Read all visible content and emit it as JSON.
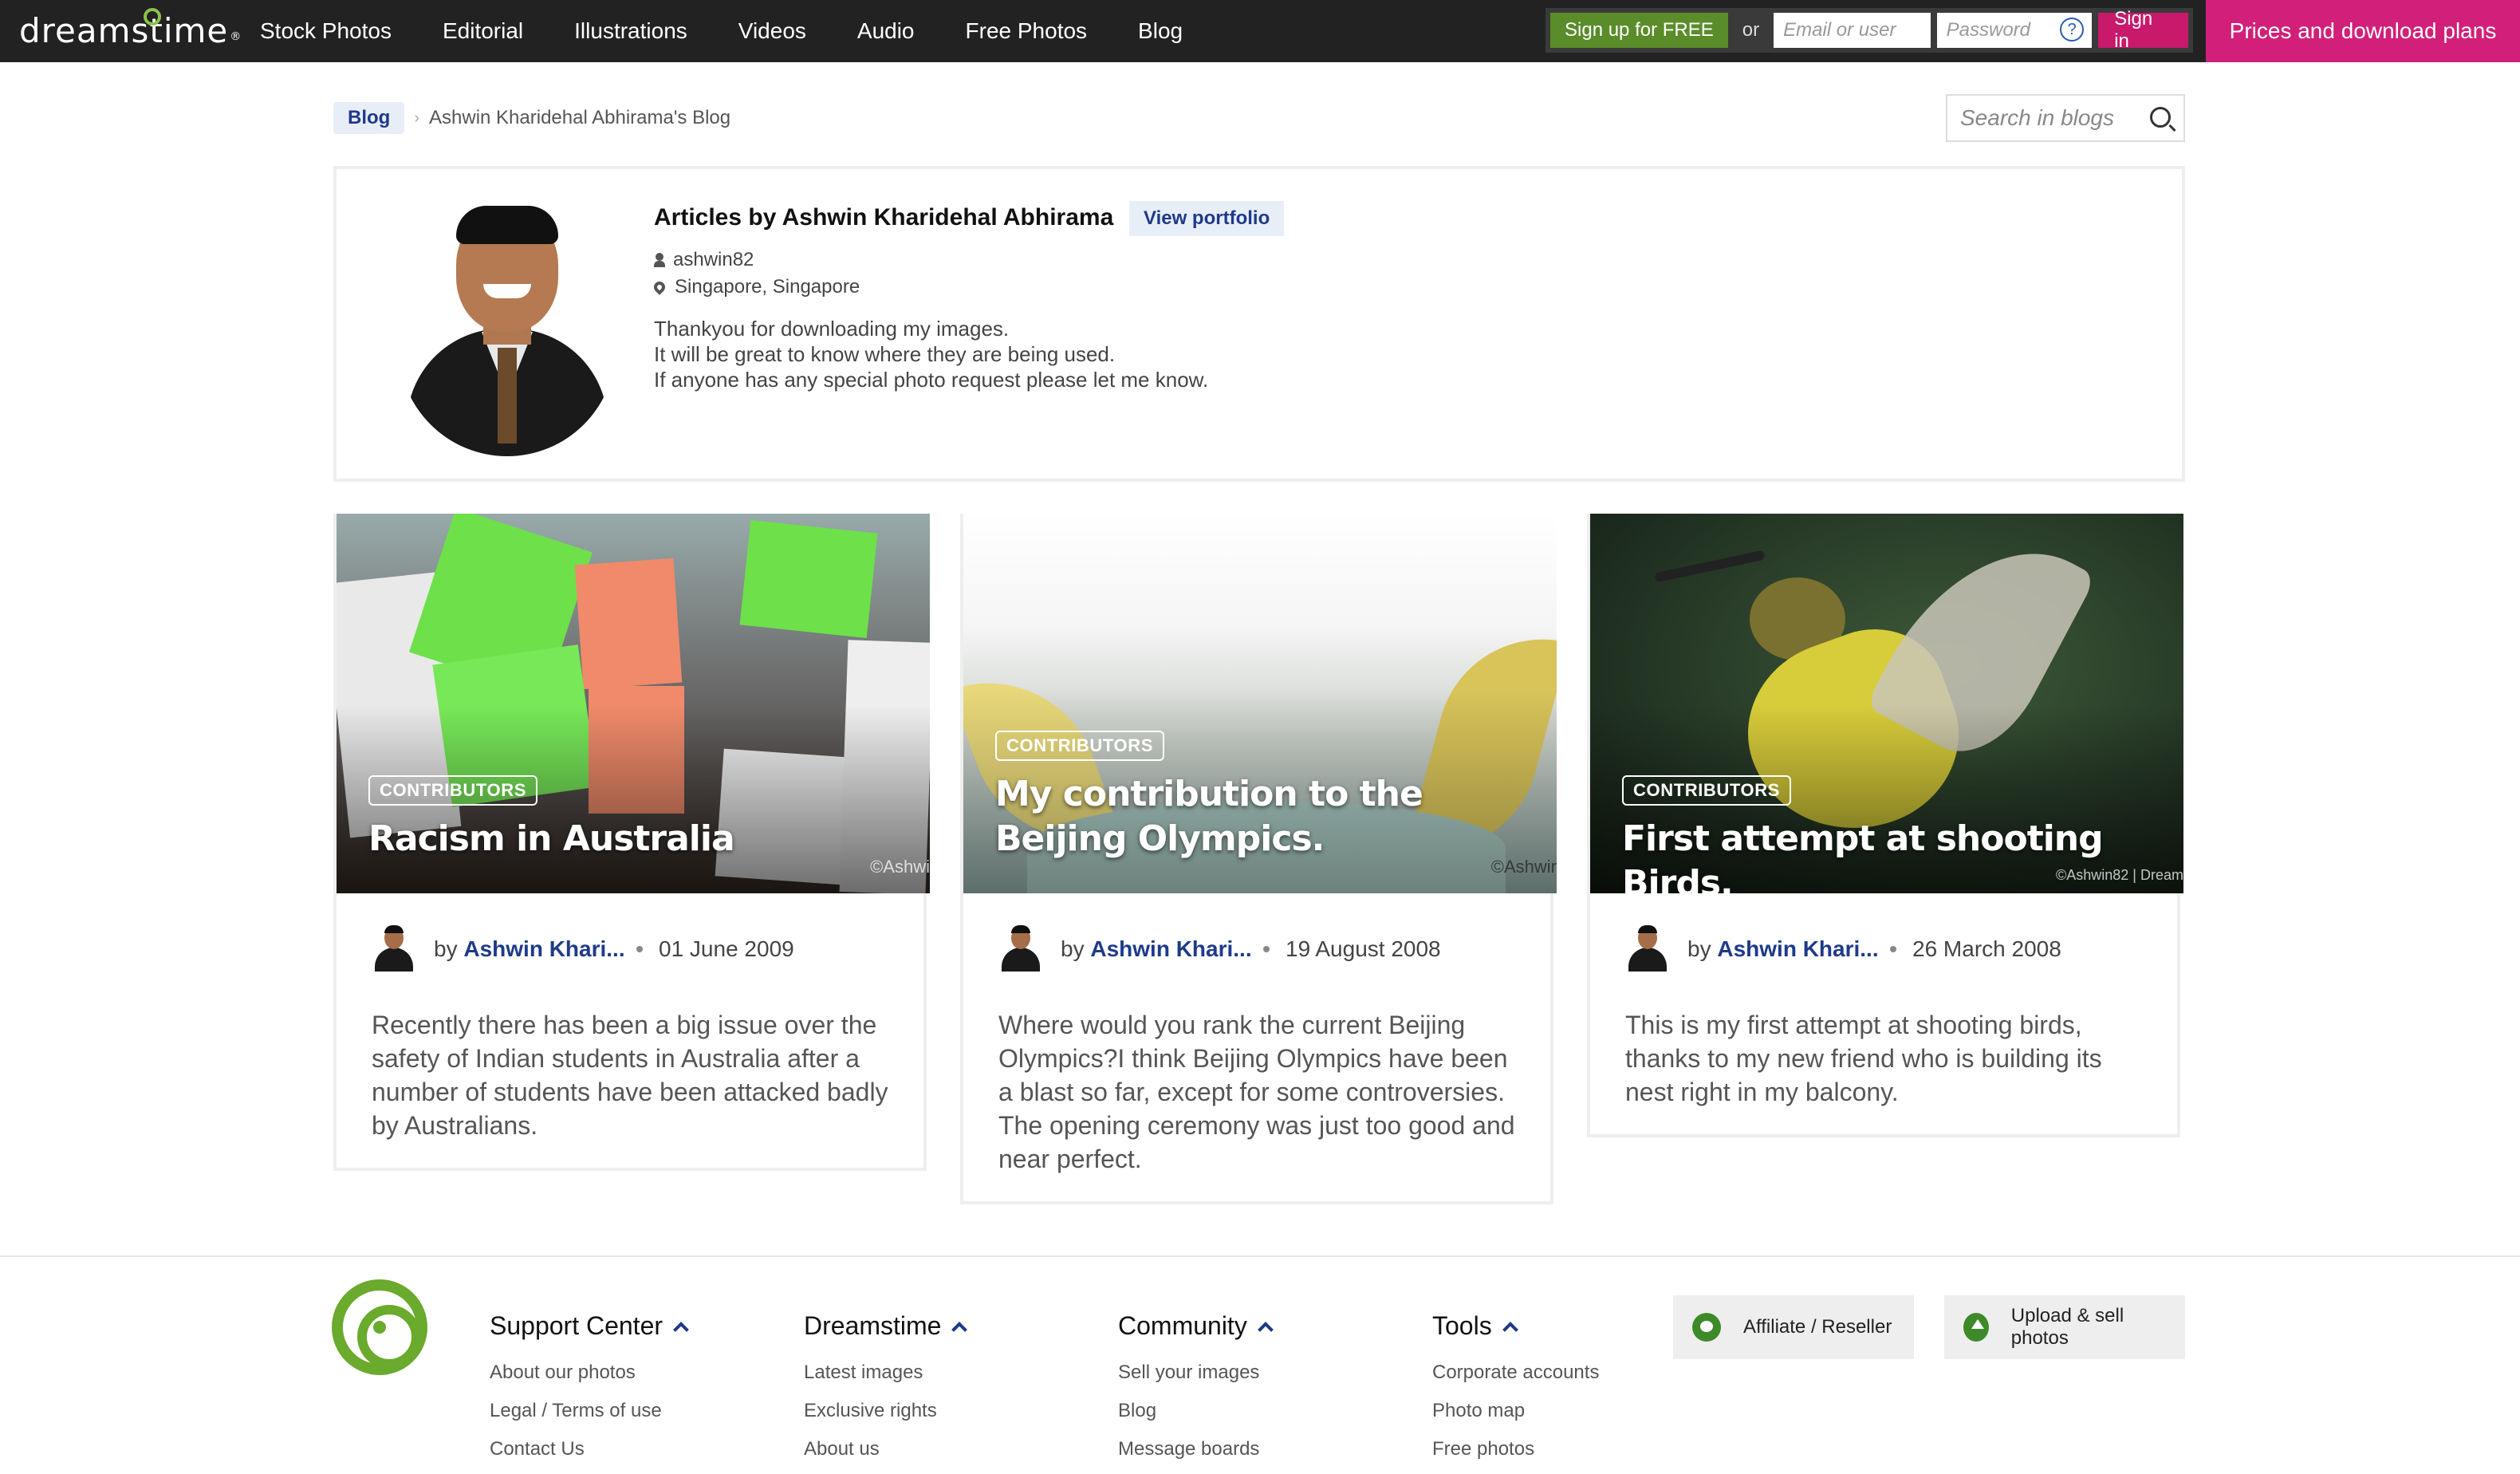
{
  "header": {
    "logo_text": "dreamstime",
    "nav": [
      "Stock Photos",
      "Editorial",
      "Illustrations",
      "Videos",
      "Audio",
      "Free Photos",
      "Blog"
    ],
    "signup_label": "Sign up for FREE",
    "or_label": "or",
    "email_placeholder": "Email or user",
    "password_placeholder": "Password",
    "help_label": "?",
    "signin_label": "Sign in",
    "prices_label": "Prices and download plans"
  },
  "breadcrumb": {
    "root": "Blog",
    "current": "Ashwin Kharidehal Abhirama's Blog"
  },
  "search": {
    "placeholder": "Search in blogs"
  },
  "profile": {
    "title": "Articles by Ashwin Kharidehal Abhirama",
    "view_portfolio": "View portfolio",
    "username": "ashwin82",
    "location": "Singapore, Singapore",
    "description": [
      "Thankyou for downloading my images.",
      "It will be great to know where they are being used.",
      "If anyone has any special photo request please let me know."
    ]
  },
  "articles": [
    {
      "category": "CONTRIBUTORS",
      "title": "Racism in Australia",
      "watermark": "©Ashwi",
      "author": "Ashwin Khari...",
      "by": "by",
      "date": "01 June 2009",
      "excerpt": "Recently there has been a big issue over the safety of Indian students in Australia after a number of students have been attacked badly by Australians."
    },
    {
      "category": "CONTRIBUTORS",
      "title": "My contribution to the Beijing Olympics.",
      "watermark": "©Ashwir",
      "author": "Ashwin Khari...",
      "by": "by",
      "date": "19 August 2008",
      "excerpt": "Where would you rank the current Beijing Olympics?I think Beijing Olympics have been a blast so far, except for some controversies. The opening ceremony was just too good and near perfect."
    },
    {
      "category": "CONTRIBUTORS",
      "title": "First attempt at shooting Birds.",
      "watermark": "©Ashwin82 | Dream",
      "author": "Ashwin Khari...",
      "by": "by",
      "date": "26 March 2008",
      "excerpt": "This is my first attempt at shooting birds, thanks to my new friend who is building its nest right in my balcony."
    }
  ],
  "footer": {
    "columns": [
      {
        "title": "Support Center",
        "links": [
          "About our photos",
          "Legal / Terms of use",
          "Contact Us"
        ]
      },
      {
        "title": "Dreamstime",
        "links": [
          "Latest images",
          "Exclusive rights",
          "About us"
        ]
      },
      {
        "title": "Community",
        "links": [
          "Sell your images",
          "Blog",
          "Message boards"
        ]
      },
      {
        "title": "Tools",
        "links": [
          "Corporate accounts",
          "Photo map",
          "Free photos"
        ]
      }
    ],
    "affiliate_label": "Affiliate / Reseller",
    "upload_label": "Upload & sell photos"
  },
  "colors": {
    "accent": "#d21f79",
    "signup": "#5b8c2a",
    "link": "#1e3a8a",
    "brand_green": "#6aaa2c"
  }
}
